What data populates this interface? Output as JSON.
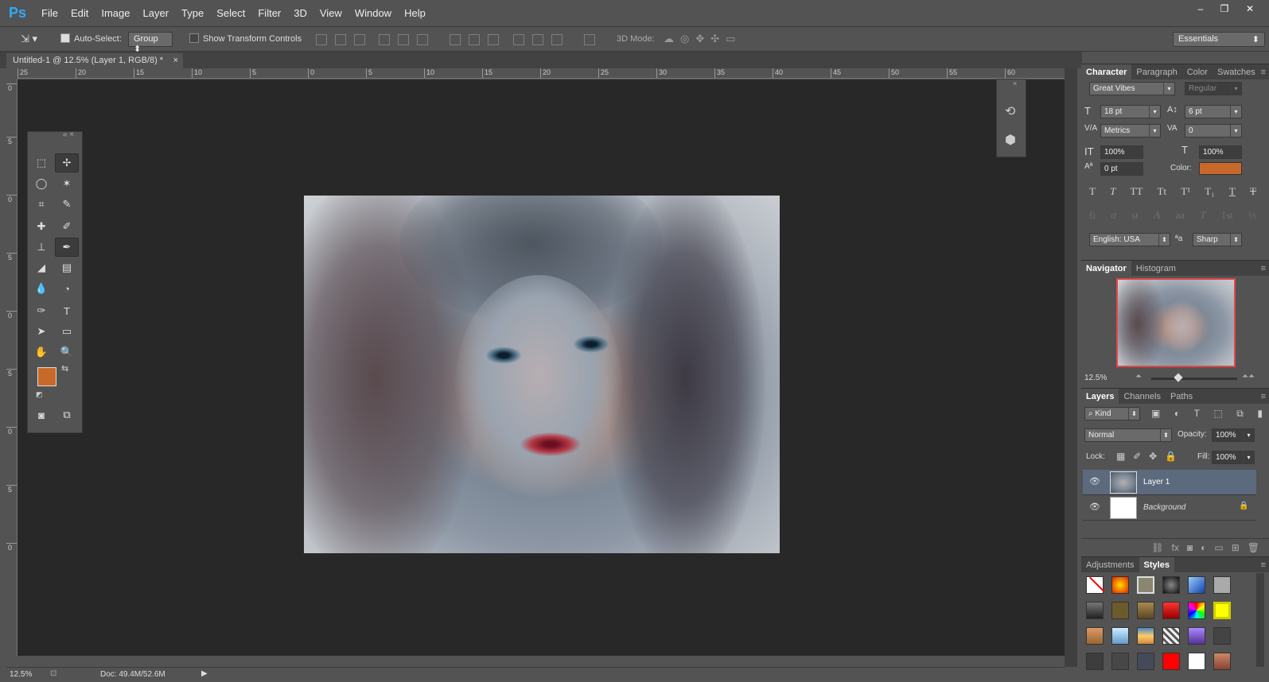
{
  "app": {
    "logo": "Ps",
    "brand_color": "#31a8ff"
  },
  "menu": [
    "File",
    "Edit",
    "Image",
    "Layer",
    "Type",
    "Select",
    "Filter",
    "3D",
    "View",
    "Window",
    "Help"
  ],
  "window_controls": [
    "–",
    "❐",
    "✕"
  ],
  "options": {
    "auto_select_label": "Auto-Select:",
    "auto_select_checked": true,
    "group_value": "Group",
    "transform_label": "Show Transform Controls",
    "transform_checked": false,
    "mode_3d_label": "3D Mode:",
    "workspace": "Essentials"
  },
  "document": {
    "tab_title": "Untitled-1 @ 12.5% (Layer 1, RGB/8) *",
    "close": "×"
  },
  "ruler_top": [
    "25",
    "20",
    "15",
    "10",
    "5",
    "0",
    "5",
    "10",
    "15",
    "20",
    "25",
    "30",
    "35",
    "40",
    "45",
    "50",
    "55",
    "60"
  ],
  "ruler_left": [
    "0",
    "5",
    "0",
    "5",
    "0",
    "5",
    "0",
    "5",
    "0"
  ],
  "status": {
    "zoom": "12.5%",
    "doc": "Doc: 49.4M/52.6M"
  },
  "colors": {
    "foreground": "#c8692a",
    "background": "#282828",
    "panel": "#535353",
    "workspace": "#282828"
  },
  "character": {
    "tabs": [
      "Character",
      "Paragraph",
      "Color",
      "Swatches"
    ],
    "font_family": "Great Vibes",
    "font_style": "Regular",
    "size": "18 pt",
    "leading": "6 pt",
    "kerning": "Metrics",
    "tracking": "0",
    "vscale": "100%",
    "hscale": "100%",
    "baseline": "0 pt",
    "color_label": "Color:",
    "text_color": "#c8692a",
    "style_buttons": [
      "T",
      "T",
      "TT",
      "Tt",
      "T¹",
      "T₁",
      "T",
      "T"
    ],
    "opentype_buttons": [
      "fi",
      "ơ",
      "st",
      "A",
      "aa",
      "T",
      "1st",
      "½"
    ],
    "language": "English: USA",
    "aa_icon": "ªa",
    "antialias": "Sharp"
  },
  "navigator": {
    "tabs": [
      "Navigator",
      "Histogram"
    ],
    "zoom": "12.5%"
  },
  "layers": {
    "tabs": [
      "Layers",
      "Channels",
      "Paths"
    ],
    "filter_kind": "Kind",
    "blend_mode": "Normal",
    "opacity_label": "Opacity:",
    "opacity": "100%",
    "lock_label": "Lock:",
    "fill_label": "Fill:",
    "fill": "100%",
    "items": [
      {
        "name": "Layer 1",
        "selected": true
      },
      {
        "name": "Background",
        "selected": false,
        "locked": true
      }
    ]
  },
  "styles": {
    "tabs": [
      "Adjustments",
      "Styles"
    ]
  }
}
